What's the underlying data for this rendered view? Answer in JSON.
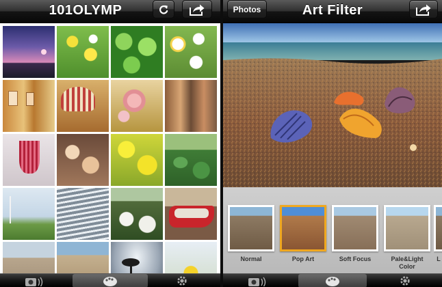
{
  "left_screen": {
    "title": "101OLYMP",
    "refresh_icon": "refresh-icon",
    "share_icon": "share-icon",
    "grid": {
      "rows": 5,
      "columns": 4,
      "photos": [
        {
          "subject": "sunset over sea"
        },
        {
          "subject": "yellow flowers"
        },
        {
          "subject": "green clover"
        },
        {
          "subject": "white daisies"
        },
        {
          "subject": "jars"
        },
        {
          "subject": "hat"
        },
        {
          "subject": "pink flowers"
        },
        {
          "subject": "shop display"
        },
        {
          "subject": "shell chimes"
        },
        {
          "subject": "shells"
        },
        {
          "subject": "yellow rapeseed"
        },
        {
          "subject": "cabbage field"
        },
        {
          "subject": "windmill"
        },
        {
          "subject": "marina"
        },
        {
          "subject": "white flower bush"
        },
        {
          "subject": "red boat"
        },
        {
          "subject": "beach"
        },
        {
          "subject": "beach shells"
        },
        {
          "subject": "palm trees"
        },
        {
          "subject": "yellow bloom"
        }
      ]
    },
    "tabbar": {
      "tabs": [
        {
          "icon": "camera-icon",
          "active": false
        },
        {
          "icon": "palette-icon",
          "active": true
        },
        {
          "icon": "gear-icon",
          "active": false
        }
      ]
    }
  },
  "right_screen": {
    "title": "Art Filter",
    "back_button_label": "Photos",
    "share_icon": "share-icon",
    "filters": [
      {
        "label": "Normal",
        "selected": false
      },
      {
        "label": "Pop Art",
        "selected": true
      },
      {
        "label": "Soft Focus",
        "selected": false
      },
      {
        "label": "Pale&Light Color",
        "selected": false
      },
      {
        "label": "L",
        "selected": false
      }
    ],
    "tabbar": {
      "tabs": [
        {
          "icon": "camera-icon",
          "active": false
        },
        {
          "icon": "palette-icon",
          "active": true
        },
        {
          "icon": "gear-icon",
          "active": false
        }
      ]
    }
  },
  "colors": {
    "selection": "#f0a81f",
    "navbar_dark": "#141414",
    "filter_panel": "#c4c4c4"
  }
}
